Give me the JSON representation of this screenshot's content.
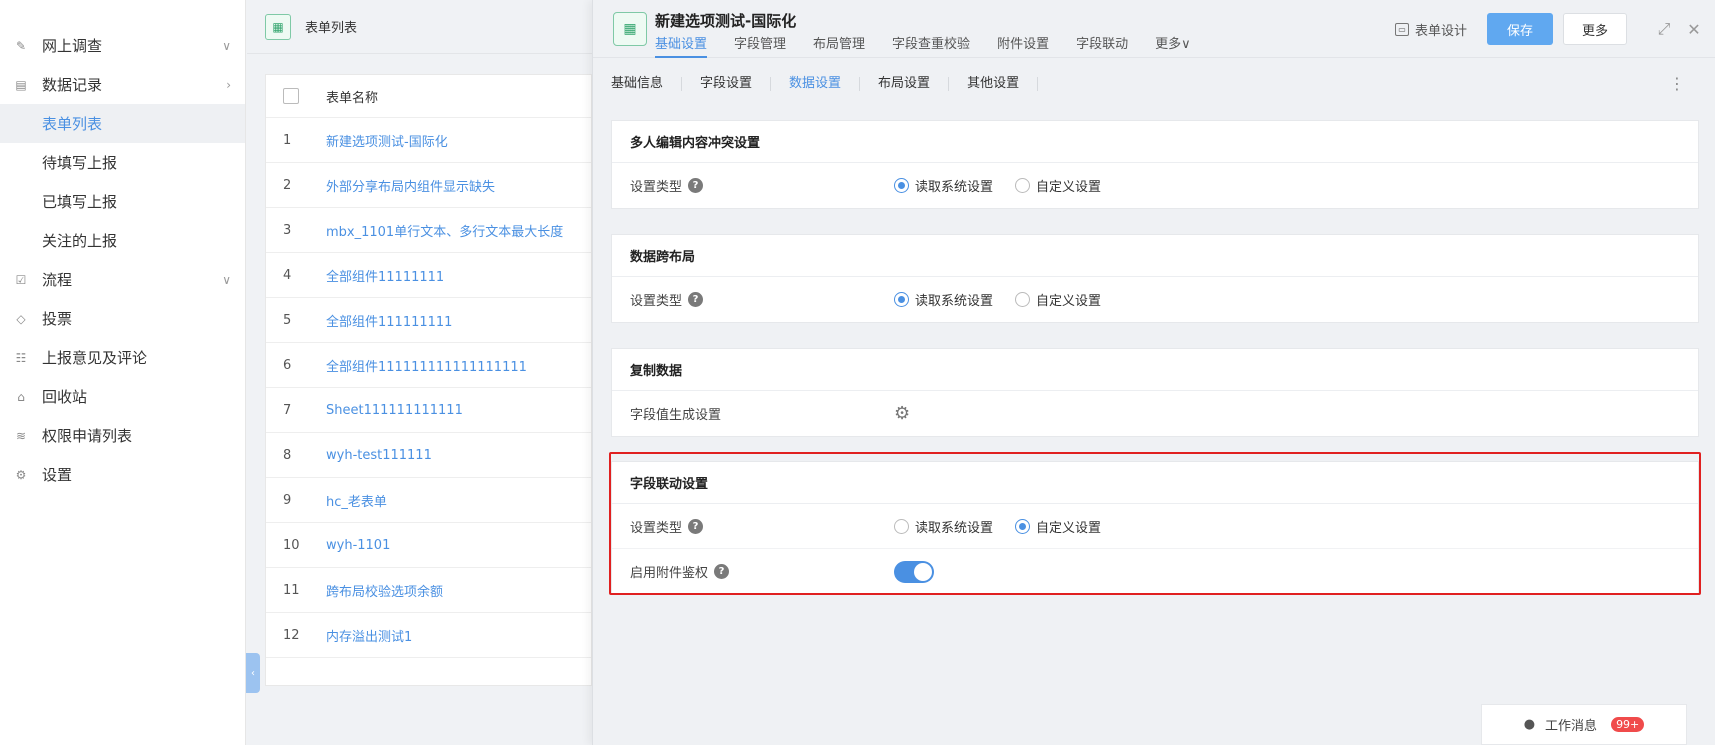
{
  "sidebar": {
    "items": [
      {
        "label": "网上调查",
        "icon": "edit-icon",
        "chevron": "∨"
      },
      {
        "label": "数据记录",
        "icon": "record-icon",
        "chevron": "›"
      },
      {
        "label": "流程",
        "icon": "flow-icon",
        "chevron": "∨"
      },
      {
        "label": "投票",
        "icon": "vote-icon"
      },
      {
        "label": "上报意见及评论",
        "icon": "comment-icon"
      },
      {
        "label": "回收站",
        "icon": "trash-icon"
      },
      {
        "label": "权限申请列表",
        "icon": "layers-icon"
      },
      {
        "label": "设置",
        "icon": "gear-icon"
      }
    ],
    "sub_items": [
      "表单列表",
      "待填写上报",
      "已填写上报",
      "关注的上报"
    ]
  },
  "list": {
    "title": "表单列表",
    "column_name": "表单名称",
    "rows": [
      {
        "no": "1",
        "name": "新建选项测试-国际化"
      },
      {
        "no": "2",
        "name": "外部分享布局内组件显示缺失"
      },
      {
        "no": "3",
        "name": "mbx_1101单行文本、多行文本最大长度"
      },
      {
        "no": "4",
        "name": "全部组件11111111"
      },
      {
        "no": "5",
        "name": "全部组件111111111"
      },
      {
        "no": "6",
        "name": "全部组件111111111111111111"
      },
      {
        "no": "7",
        "name": "Sheet111111111111"
      },
      {
        "no": "8",
        "name": "wyh-test111111"
      },
      {
        "no": "9",
        "name": "hc_老表单"
      },
      {
        "no": "10",
        "name": "wyh-1101"
      },
      {
        "no": "11",
        "name": "跨布局校验选项余额"
      },
      {
        "no": "12",
        "name": "内存溢出测试1"
      }
    ]
  },
  "detail": {
    "title": "新建选项测试-国际化",
    "tabs": [
      "基础设置",
      "字段管理",
      "布局管理",
      "字段查重校验",
      "附件设置",
      "字段联动",
      "更多∨"
    ],
    "design_label": "表单设计",
    "save_label": "保存",
    "more_label": "更多",
    "subtabs": [
      "基础信息",
      "字段设置",
      "数据设置",
      "布局设置",
      "其他设置"
    ],
    "cards": {
      "conflict": {
        "title": "多人编辑内容冲突设置",
        "label": "设置类型",
        "opt1": "读取系统设置",
        "opt2": "自定义设置"
      },
      "cross": {
        "title": "数据跨布局",
        "label": "设置类型",
        "opt1": "读取系统设置",
        "opt2": "自定义设置"
      },
      "copy": {
        "title": "复制数据",
        "label": "字段值生成设置"
      },
      "linkage": {
        "title": "字段联动设置",
        "label": "设置类型",
        "opt1": "读取系统设置",
        "opt2": "自定义设置",
        "auth_label": "启用附件鉴权",
        "auth_enabled": true
      }
    }
  },
  "work_message": {
    "label": "工作消息",
    "badge": "99+"
  },
  "colors": {
    "accent": "#4a90e2",
    "save": "#60a8f0",
    "highlight": "#e02020",
    "badge": "#f04b4b"
  }
}
